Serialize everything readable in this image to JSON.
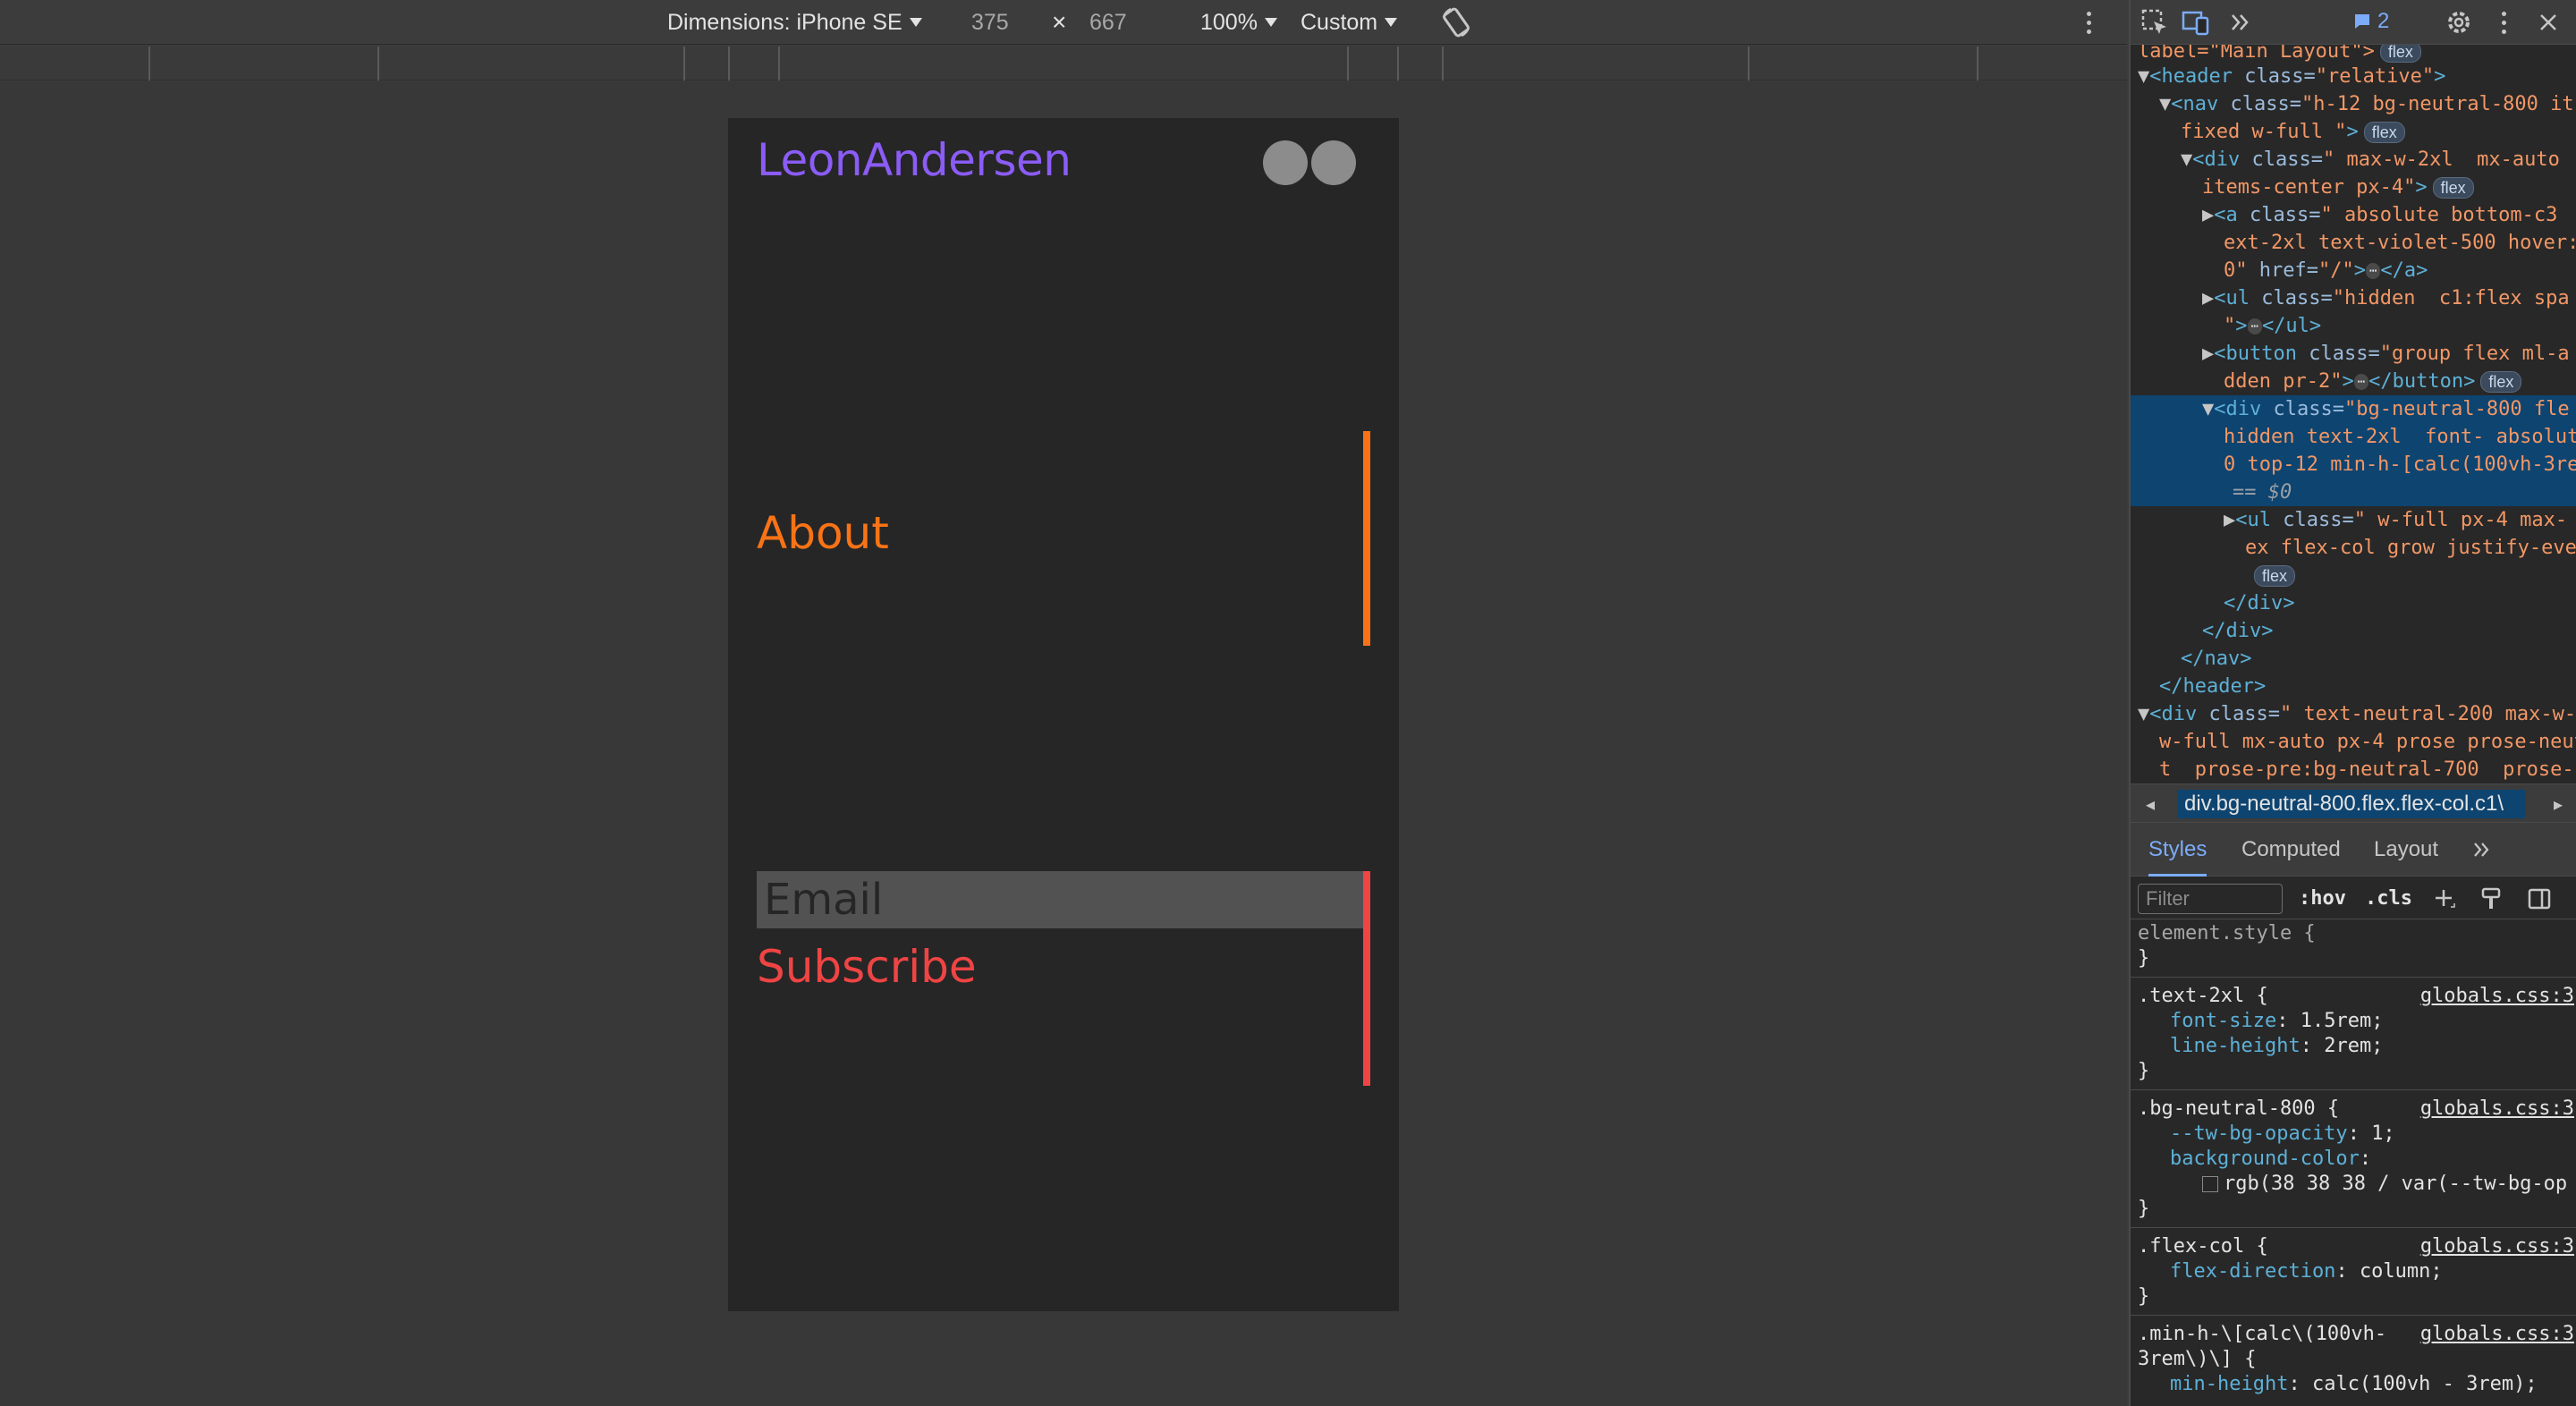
{
  "device_toolbar": {
    "dimensions_label": "Dimensions: iPhone SE",
    "width": "375",
    "times": "×",
    "height": "667",
    "zoom": "100%",
    "throttle": "Custom"
  },
  "page": {
    "logo": "LeonAndersen",
    "nav_about": "About",
    "email_placeholder": "Email",
    "subscribe": "Subscribe",
    "colors": {
      "logo": "#8b5cf6",
      "about": "#f97316",
      "subscribe": "#ef4444",
      "page_bg": "#262626"
    }
  },
  "devtools": {
    "issues_count": "2",
    "tree": {
      "l0": "label=\"Main Layout\">",
      "l1_tag": "<header ",
      "l1_attr": "class=",
      "l1_val": "\"relative\"",
      "l1_end": ">",
      "l2_tag": "<nav ",
      "l2_attr": "class=",
      "l2_val": "\"h-12 bg-neutral-800 it",
      "l3_val": "fixed w-full \"",
      "l3_end": ">",
      "l4_tag": "<div ",
      "l4_attr": "class=",
      "l4_val": "\" max-w-2xl  mx-auto",
      "l5_val": "items-center px-4\"",
      "l5_end": ">",
      "l6_tag": "<a ",
      "l6_attr": "class=",
      "l6_val": "\" absolute bottom-c3",
      "l7_val": "ext-2xl text-violet-500 hover:",
      "l8_val": "0\" ",
      "l8_attr": "href=",
      "l8_val2": "\"/\"",
      "l8_end": ">",
      "l8_close": "</a>",
      "l9_tag": "<ul ",
      "l9_attr": "class=",
      "l9_val": "\"hidden  c1:flex spa",
      "l10_val": "\"",
      "l10_end": ">",
      "l10_close": "</ul>",
      "l11_tag": "<button ",
      "l11_attr": "class=",
      "l11_val": "\"group flex ml-a",
      "l12_val": "dden pr-2\"",
      "l12_end": ">",
      "l12_close": "</button>",
      "l13_tag": "<div ",
      "l13_attr": "class=",
      "l13_val": "\"bg-neutral-800 fle",
      "l14_val": "hidden text-2xl  font- absolut",
      "l15_val": "0 top-12 min-h-[calc(100vh-3re",
      "l16": "== $0",
      "l17_tag": "<ul ",
      "l17_attr": "class=",
      "l17_val": "\" w-full px-4 max-",
      "l18_val": "ex flex-col grow justify-eve",
      "l20": "</div>",
      "l21": "</div>",
      "l22": "</nav>",
      "l23": "</header>",
      "l24_tag": "<div ",
      "l24_attr": "class=",
      "l24_val": "\" text-neutral-200 max-w-",
      "l25_val": "w-full mx-auto px-4 prose prose-neut",
      "l26_val": "t  prose-pre:bg-neutral-700  prose-",
      "pill": "flex",
      "ellipsis": "⋯"
    },
    "breadcrumb": "div.bg-neutral-800.flex.flex-col.c1\\",
    "tabs": [
      "Styles",
      "Computed",
      "Layout"
    ],
    "filter_placeholder": "Filter",
    "hov": ":hov",
    "cls": ".cls",
    "rules": {
      "element_style": "element.style {",
      "close": "}",
      "r1_sel": ".text-2xl {",
      "r1_src": "globals.css:3",
      "r1_p1": "font-size",
      "r1_v1": "1.5rem;",
      "r1_p2": "line-height",
      "r1_v2": "2rem;",
      "r2_sel": ".bg-neutral-800 {",
      "r2_src": "globals.css:3",
      "r2_p1": "--tw-bg-opacity",
      "r2_v1": "1;",
      "r2_p2": "background-color",
      "r2_v2": "rgb(38 38 38 / var(--tw-bg-op",
      "r3_sel": ".flex-col {",
      "r3_src": "globals.css:3",
      "r3_p1": "flex-direction",
      "r3_v1": "column;",
      "r4_sel1": ".min-h-\\[calc\\(100vh-",
      "r4_sel2": "3rem\\)\\] {",
      "r4_src": "globals.css:3",
      "r4_p1": "min-height",
      "r4_v1": "calc(100vh - 3rem);"
    }
  }
}
